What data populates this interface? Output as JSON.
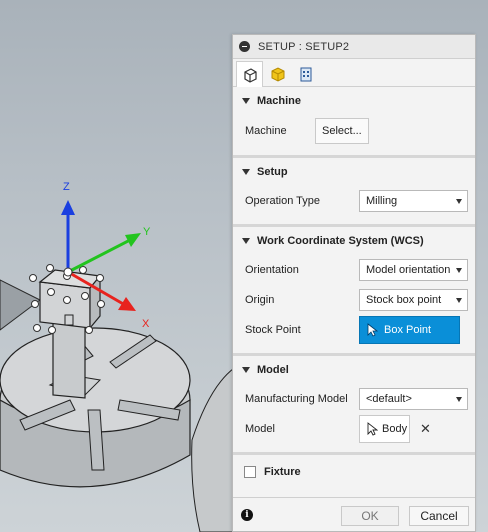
{
  "dialog": {
    "title": "SETUP : SETUP2",
    "tabs": [
      {
        "icon": "setup-tab-icon",
        "active": true
      },
      {
        "icon": "stock-tab-icon",
        "active": false
      },
      {
        "icon": "post-process-tab-icon",
        "active": false
      }
    ],
    "machine": {
      "header": "Machine",
      "label": "Machine",
      "button": "Select..."
    },
    "setup": {
      "header": "Setup",
      "operation_type_label": "Operation Type",
      "operation_type_value": "Milling"
    },
    "wcs": {
      "header": "Work Coordinate System (WCS)",
      "orientation_label": "Orientation",
      "orientation_value": "Model orientation",
      "origin_label": "Origin",
      "origin_value": "Stock box point",
      "stock_point_label": "Stock Point",
      "stock_point_button": "Box Point"
    },
    "model": {
      "header": "Model",
      "manufacturing_model_label": "Manufacturing Model",
      "manufacturing_model_value": "<default>",
      "model_label": "Model",
      "model_button": "Body"
    },
    "fixture": {
      "label": "Fixture",
      "checked": false
    },
    "footer": {
      "ok": "OK",
      "cancel": "Cancel"
    }
  },
  "viewport": {
    "axes": {
      "x": "X",
      "y": "Y",
      "z": "Z"
    },
    "axis_colors": {
      "x": "#e8231e",
      "y": "#22c41e",
      "z": "#1a3fe0"
    },
    "accent": "#0a8fd8"
  }
}
